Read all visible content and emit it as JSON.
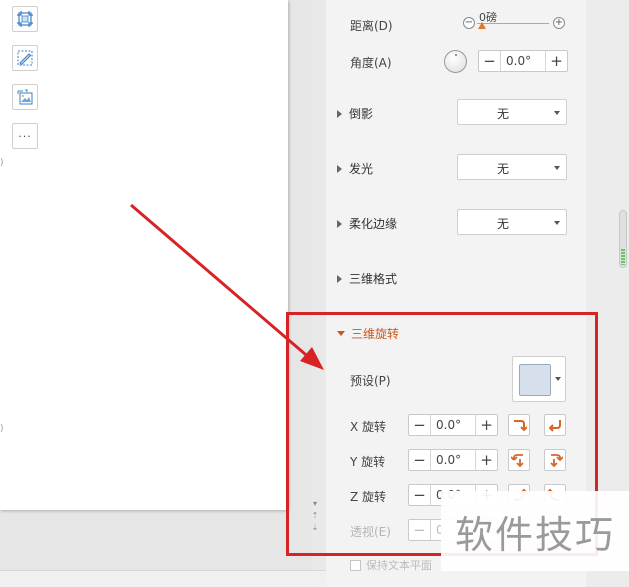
{
  "toolbar_icons": [
    "crop-icon",
    "edit-shape-icon",
    "change-picture-icon",
    "more-icon"
  ],
  "more_label": "···",
  "shadow": {
    "distance_label": "距离(D)",
    "distance_value": "0磅",
    "angle_label": "角度(A)",
    "angle_value": "0.0°"
  },
  "sections": {
    "reflection": {
      "label": "倒影",
      "value": "无"
    },
    "glow": {
      "label": "发光",
      "value": "无"
    },
    "soft_edges": {
      "label": "柔化边缘",
      "value": "无"
    },
    "format_3d": {
      "label": "三维格式"
    },
    "rotation_3d": {
      "label": "三维旋转"
    }
  },
  "rotation": {
    "preset_label": "预设(P)",
    "x_label": "X 旋转",
    "x_value": "0.0°",
    "y_label": "Y 旋转",
    "y_value": "0.0°",
    "z_label": "Z 旋转",
    "z_value": "0.0°",
    "perspective_label": "透视(E)",
    "perspective_value": "0",
    "keep_text_flat": "保持文本平面"
  },
  "stepper_minus": "−",
  "stepper_plus": "+",
  "watermark": "软件技巧",
  "colors": {
    "accent_orange": "#c8581e",
    "highlight_red": "#d62424",
    "preset_swatch": "#d6e0ec"
  }
}
